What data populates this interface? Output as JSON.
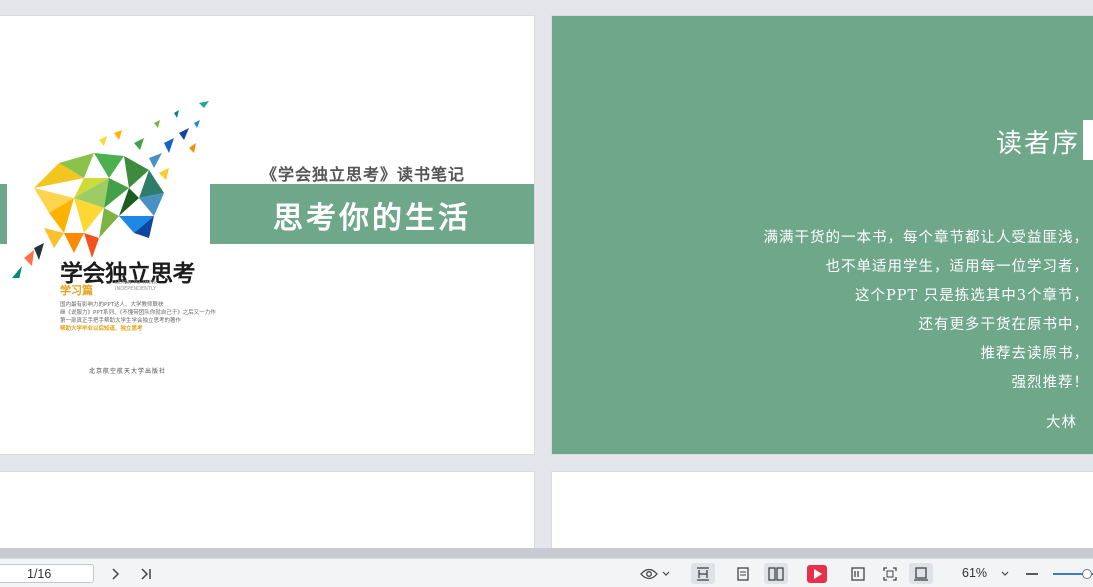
{
  "slide1": {
    "subtitle": "《学会独立思考》读书笔记",
    "banner_title": "思考你的生活",
    "book": {
      "title": "学会独立思考",
      "sub": "学习篇",
      "en": "LEARN TO THINK INDEPENDENTLY",
      "line1": "国内最有影响力的PPT达人、大学教师联袂",
      "line2": "继《说服力》PPT系列、《不懂带团队你就自己干》之后又一力作",
      "line3": "第一部真正手把手帮助大学生学会独立思考的著作",
      "line4": "帮助大学毕业以后知道、独立思考",
      "publisher": "北京航空航天大学出版社"
    }
  },
  "slide2": {
    "title": "读者序",
    "lines": [
      "满满干货的一本书，每个章节都让人受益匪浅，",
      "也不单适用学生，适用每一位学习者，",
      "这个PPT 只是拣选其中3个章节，",
      "还有更多干货在原书中，",
      "推荐去读原书，",
      "强烈推荐！"
    ],
    "author": "大林"
  },
  "statusbar": {
    "page_indicator": "1/16",
    "zoom": "61%"
  },
  "colors": {
    "accent_green": "#6fa78a",
    "play_red": "#e8304a",
    "slider_blue": "#3a7bd5"
  },
  "icons": [
    "next-page-icon",
    "last-page-icon",
    "eye-icon",
    "chevron-down-icon",
    "fit-height-icon",
    "single-page-icon",
    "dual-page-icon",
    "play-icon",
    "note-icon",
    "fullscreen-icon",
    "fit-page-icon",
    "zoom-out-icon"
  ]
}
